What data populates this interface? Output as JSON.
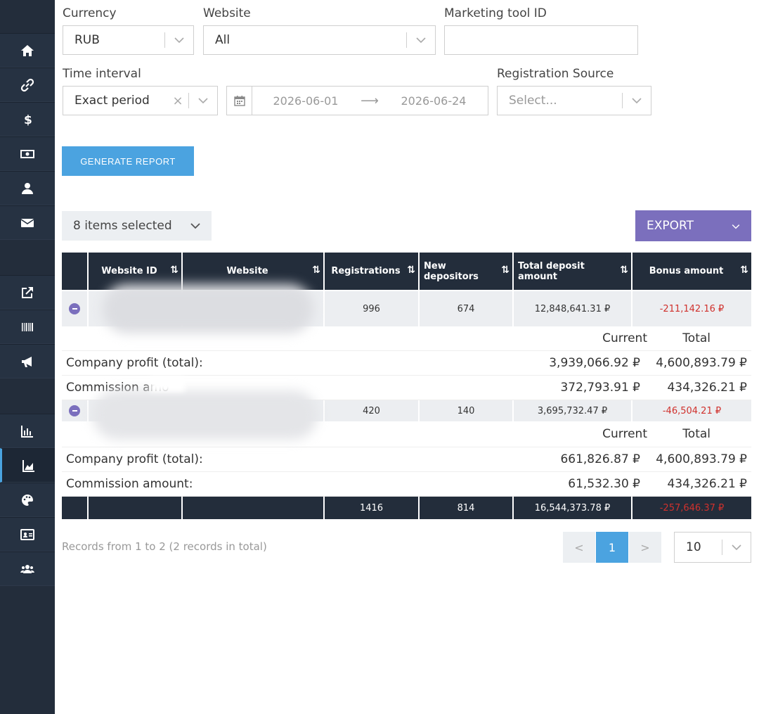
{
  "sidebar": {
    "items": [
      "home-icon",
      "link-icon",
      "dollar-icon",
      "money-icon",
      "user-icon",
      "mail-icon",
      "external-link-icon",
      "barcode-icon",
      "megaphone-icon",
      "bar-chart-icon",
      "area-chart-icon",
      "palette-icon",
      "id-card-icon",
      "users-icon"
    ],
    "active": "area-chart-icon"
  },
  "filters": {
    "currency_label": "Currency",
    "currency_value": "RUB",
    "website_label": "Website",
    "website_value": "All",
    "marketing_label": "Marketing tool ID",
    "marketing_value": "",
    "time_label": "Time interval",
    "time_value": "Exact period",
    "clear_symbol": "×",
    "date_from": "2026-06-01",
    "date_arrow": "⟶",
    "date_to": "2026-06-24",
    "regsource_label": "Registration Source",
    "regsource_placeholder": "Select..."
  },
  "actions": {
    "generate": "GENERATE REPORT",
    "columns": "8 items selected",
    "export": "EXPORT"
  },
  "table": {
    "headers": [
      "Website ID",
      "Website",
      "Registrations",
      "New depositors",
      "Total deposit amount",
      "Bonus amount"
    ],
    "sort_symbol": "⇅",
    "rows": [
      {
        "website_id": "",
        "website": "",
        "registrations": "996",
        "new_depositors": "674",
        "total_deposit": "12,848,641.31 ₽",
        "bonus": "-211,142.16 ₽",
        "summary": {
          "current_label": "Current",
          "total_label": "Total",
          "profit_label": "Company profit (total):",
          "profit_current": "3,939,066.92 ₽",
          "profit_total": "4,600,893.79 ₽",
          "commission_label": "Commission amo",
          "commission_current": "372,793.91 ₽",
          "commission_total": "434,326.21 ₽"
        }
      },
      {
        "website_id": "",
        "website": "",
        "registrations": "420",
        "new_depositors": "140",
        "total_deposit": "3,695,732.47 ₽",
        "bonus": "-46,504.21 ₽",
        "summary": {
          "current_label": "Current",
          "total_label": "Total",
          "profit_label": "Company profit (total):",
          "profit_current": "661,826.87 ₽",
          "profit_total": "4,600,893.79 ₽",
          "commission_label": "Commission amount:",
          "commission_current": "61,532.30 ₽",
          "commission_total": "434,326.21 ₽"
        }
      }
    ],
    "footer": {
      "registrations": "1416",
      "new_depositors": "814",
      "total_deposit": "16,544,373.78 ₽",
      "bonus": "-257,646.37 ₽"
    }
  },
  "pagination": {
    "records": "Records from 1 to 2 (2 records in total)",
    "prev": "<",
    "current": "1",
    "next": ">",
    "page_size": "10"
  }
}
